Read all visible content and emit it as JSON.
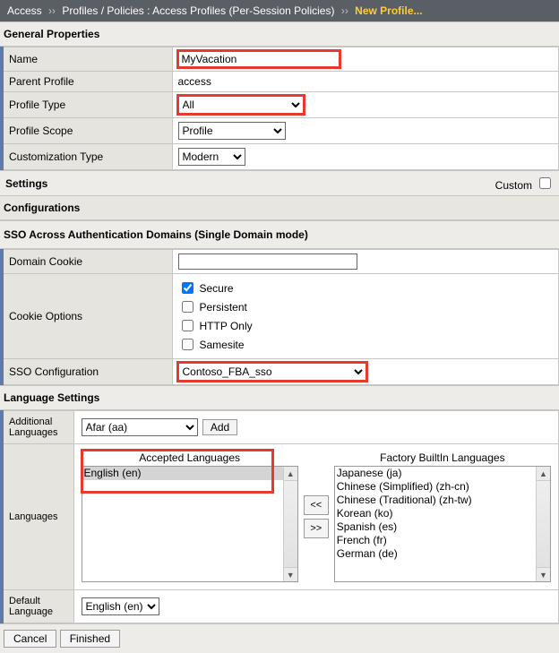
{
  "breadcrumb": {
    "root": "Access",
    "path": "Profiles / Policies : Access Profiles (Per-Session Policies)",
    "current": "New Profile..."
  },
  "sections": {
    "general": "General Properties",
    "settings": "Settings",
    "custom_label": "Custom",
    "configurations": "Configurations",
    "sso": "SSO Across Authentication Domains (Single Domain mode)",
    "lang": "Language Settings"
  },
  "general": {
    "name_label": "Name",
    "name_value": "MyVacation",
    "parent_label": "Parent Profile",
    "parent_value": "access",
    "type_label": "Profile Type",
    "type_value": "All",
    "scope_label": "Profile Scope",
    "scope_value": "Profile",
    "custtype_label": "Customization Type",
    "custtype_value": "Modern"
  },
  "sso": {
    "domain_cookie_label": "Domain Cookie",
    "domain_cookie_value": "",
    "cookie_options_label": "Cookie Options",
    "opt_secure": "Secure",
    "opt_persistent": "Persistent",
    "opt_httponly": "HTTP Only",
    "opt_samesite": "Samesite",
    "sso_config_label": "SSO Configuration",
    "sso_config_value": "Contoso_FBA_sso"
  },
  "lang": {
    "addl_label": "Additional Languages",
    "addl_value": "Afar (aa)",
    "add_btn": "Add",
    "languages_label": "Languages",
    "accepted_header": "Accepted Languages",
    "factory_header": "Factory BuiltIn Languages",
    "accepted_items": [
      "English (en)"
    ],
    "factory_items": [
      "Japanese (ja)",
      "Chinese (Simplified) (zh-cn)",
      "Chinese (Traditional) (zh-tw)",
      "Korean (ko)",
      "Spanish (es)",
      "French (fr)",
      "German (de)"
    ],
    "move_left": "<<",
    "move_right": ">>",
    "default_label": "Default Language",
    "default_value": "English (en)"
  },
  "buttons": {
    "cancel": "Cancel",
    "finished": "Finished"
  }
}
